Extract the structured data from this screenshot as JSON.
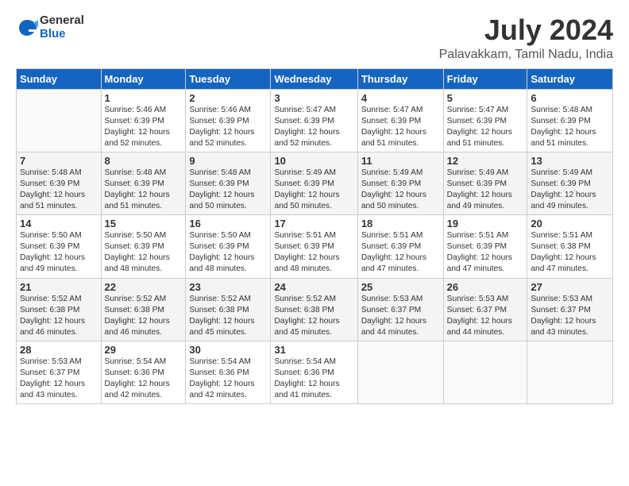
{
  "logo": {
    "general": "General",
    "blue": "Blue"
  },
  "header": {
    "title": "July 2024",
    "subtitle": "Palavakkam, Tamil Nadu, India"
  },
  "weekdays": [
    "Sunday",
    "Monday",
    "Tuesday",
    "Wednesday",
    "Thursday",
    "Friday",
    "Saturday"
  ],
  "weeks": [
    [
      {
        "day": "",
        "info": ""
      },
      {
        "day": "1",
        "info": "Sunrise: 5:46 AM\nSunset: 6:39 PM\nDaylight: 12 hours\nand 52 minutes."
      },
      {
        "day": "2",
        "info": "Sunrise: 5:46 AM\nSunset: 6:39 PM\nDaylight: 12 hours\nand 52 minutes."
      },
      {
        "day": "3",
        "info": "Sunrise: 5:47 AM\nSunset: 6:39 PM\nDaylight: 12 hours\nand 52 minutes."
      },
      {
        "day": "4",
        "info": "Sunrise: 5:47 AM\nSunset: 6:39 PM\nDaylight: 12 hours\nand 51 minutes."
      },
      {
        "day": "5",
        "info": "Sunrise: 5:47 AM\nSunset: 6:39 PM\nDaylight: 12 hours\nand 51 minutes."
      },
      {
        "day": "6",
        "info": "Sunrise: 5:48 AM\nSunset: 6:39 PM\nDaylight: 12 hours\nand 51 minutes."
      }
    ],
    [
      {
        "day": "7",
        "info": "Sunrise: 5:48 AM\nSunset: 6:39 PM\nDaylight: 12 hours\nand 51 minutes."
      },
      {
        "day": "8",
        "info": "Sunrise: 5:48 AM\nSunset: 6:39 PM\nDaylight: 12 hours\nand 51 minutes."
      },
      {
        "day": "9",
        "info": "Sunrise: 5:48 AM\nSunset: 6:39 PM\nDaylight: 12 hours\nand 50 minutes."
      },
      {
        "day": "10",
        "info": "Sunrise: 5:49 AM\nSunset: 6:39 PM\nDaylight: 12 hours\nand 50 minutes."
      },
      {
        "day": "11",
        "info": "Sunrise: 5:49 AM\nSunset: 6:39 PM\nDaylight: 12 hours\nand 50 minutes."
      },
      {
        "day": "12",
        "info": "Sunrise: 5:49 AM\nSunset: 6:39 PM\nDaylight: 12 hours\nand 49 minutes."
      },
      {
        "day": "13",
        "info": "Sunrise: 5:49 AM\nSunset: 6:39 PM\nDaylight: 12 hours\nand 49 minutes."
      }
    ],
    [
      {
        "day": "14",
        "info": "Sunrise: 5:50 AM\nSunset: 6:39 PM\nDaylight: 12 hours\nand 49 minutes."
      },
      {
        "day": "15",
        "info": "Sunrise: 5:50 AM\nSunset: 6:39 PM\nDaylight: 12 hours\nand 48 minutes."
      },
      {
        "day": "16",
        "info": "Sunrise: 5:50 AM\nSunset: 6:39 PM\nDaylight: 12 hours\nand 48 minutes."
      },
      {
        "day": "17",
        "info": "Sunrise: 5:51 AM\nSunset: 6:39 PM\nDaylight: 12 hours\nand 48 minutes."
      },
      {
        "day": "18",
        "info": "Sunrise: 5:51 AM\nSunset: 6:39 PM\nDaylight: 12 hours\nand 47 minutes."
      },
      {
        "day": "19",
        "info": "Sunrise: 5:51 AM\nSunset: 6:39 PM\nDaylight: 12 hours\nand 47 minutes."
      },
      {
        "day": "20",
        "info": "Sunrise: 5:51 AM\nSunset: 6:38 PM\nDaylight: 12 hours\nand 47 minutes."
      }
    ],
    [
      {
        "day": "21",
        "info": "Sunrise: 5:52 AM\nSunset: 6:38 PM\nDaylight: 12 hours\nand 46 minutes."
      },
      {
        "day": "22",
        "info": "Sunrise: 5:52 AM\nSunset: 6:38 PM\nDaylight: 12 hours\nand 46 minutes."
      },
      {
        "day": "23",
        "info": "Sunrise: 5:52 AM\nSunset: 6:38 PM\nDaylight: 12 hours\nand 45 minutes."
      },
      {
        "day": "24",
        "info": "Sunrise: 5:52 AM\nSunset: 6:38 PM\nDaylight: 12 hours\nand 45 minutes."
      },
      {
        "day": "25",
        "info": "Sunrise: 5:53 AM\nSunset: 6:37 PM\nDaylight: 12 hours\nand 44 minutes."
      },
      {
        "day": "26",
        "info": "Sunrise: 5:53 AM\nSunset: 6:37 PM\nDaylight: 12 hours\nand 44 minutes."
      },
      {
        "day": "27",
        "info": "Sunrise: 5:53 AM\nSunset: 6:37 PM\nDaylight: 12 hours\nand 43 minutes."
      }
    ],
    [
      {
        "day": "28",
        "info": "Sunrise: 5:53 AM\nSunset: 6:37 PM\nDaylight: 12 hours\nand 43 minutes."
      },
      {
        "day": "29",
        "info": "Sunrise: 5:54 AM\nSunset: 6:36 PM\nDaylight: 12 hours\nand 42 minutes."
      },
      {
        "day": "30",
        "info": "Sunrise: 5:54 AM\nSunset: 6:36 PM\nDaylight: 12 hours\nand 42 minutes."
      },
      {
        "day": "31",
        "info": "Sunrise: 5:54 AM\nSunset: 6:36 PM\nDaylight: 12 hours\nand 41 minutes."
      },
      {
        "day": "",
        "info": ""
      },
      {
        "day": "",
        "info": ""
      },
      {
        "day": "",
        "info": ""
      }
    ]
  ]
}
